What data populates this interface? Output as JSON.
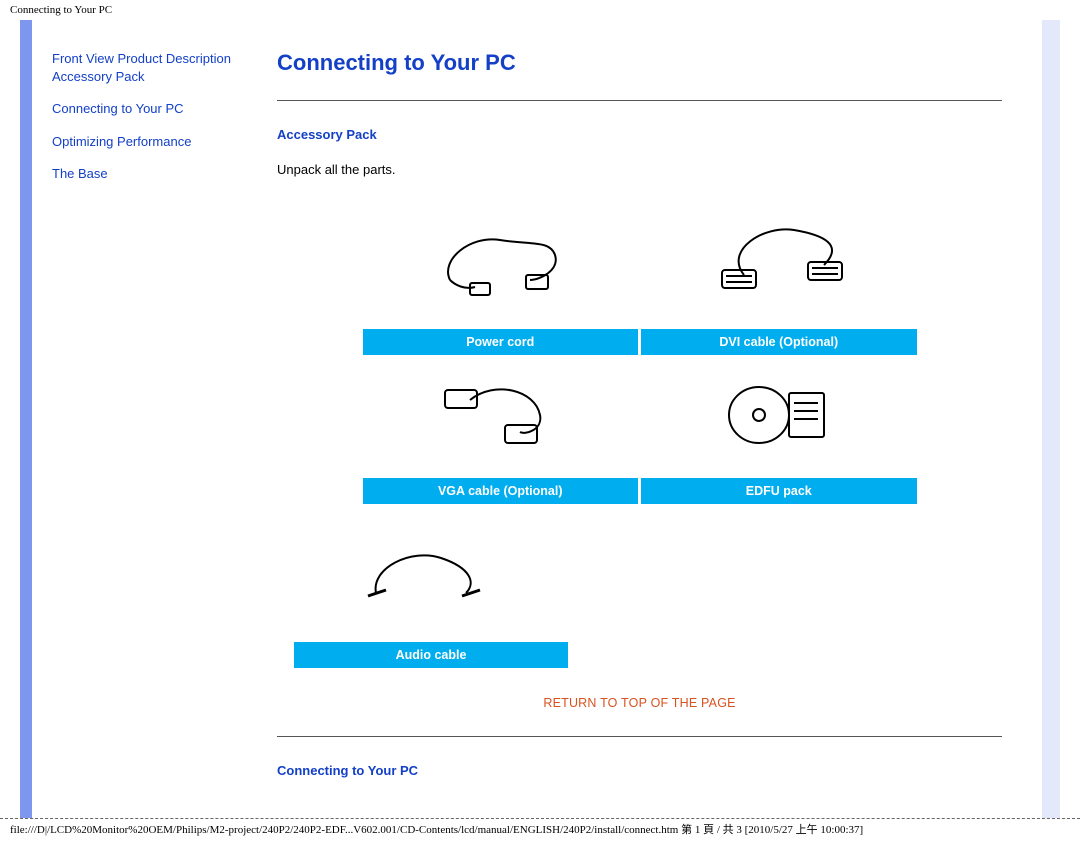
{
  "header": {
    "doc_title": "Connecting to Your PC"
  },
  "sidebar": {
    "items": [
      {
        "label": "Front View Product Description"
      },
      {
        "label": "Accessory Pack"
      },
      {
        "label": "Connecting to Your PC"
      },
      {
        "label": "Optimizing Performance"
      },
      {
        "label": "The Base"
      }
    ]
  },
  "main": {
    "title": "Connecting to Your PC",
    "section1_heading": "Accessory Pack",
    "section1_text": "Unpack all the parts.",
    "accessories": {
      "row1": [
        {
          "label": "Power cord"
        },
        {
          "label": "DVI cable (Optional)"
        }
      ],
      "row2": [
        {
          "label": "VGA cable (Optional)"
        },
        {
          "label": "EDFU pack"
        }
      ],
      "row3": [
        {
          "label": "Audio cable"
        }
      ]
    },
    "return_link": "RETURN TO TOP OF THE PAGE",
    "section2_heading": "Connecting to Your PC"
  },
  "footer": {
    "path": "file:///D|/LCD%20Monitor%20OEM/Philips/M2-project/240P2/240P2-EDF...V602.001/CD-Contents/lcd/manual/ENGLISH/240P2/install/connect.htm 第 1 頁 / 共 3  [2010/5/27 上午 10:00:37]"
  }
}
